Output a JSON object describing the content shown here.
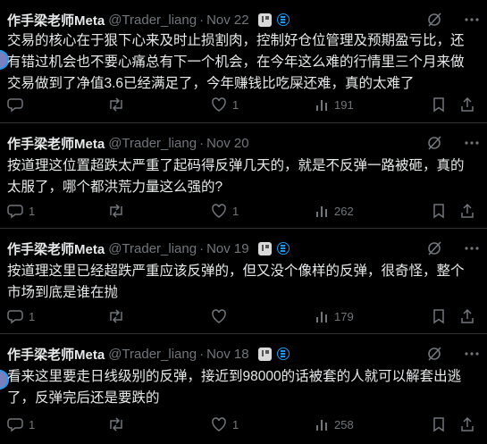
{
  "tweets": [
    {
      "name": "作手梁老师Meta",
      "handle": "@Trader_liang",
      "date": "Nov 22",
      "text": "交易的核心在于狠下心来及时止损割肉，控制好仓位管理及预期盈亏比，还有错过机会也不要心痛总有下一个机会，在今年这么难的行情里三个月来做交易做到了净值3.6已经满足了，今年赚钱比吃屎还难，真的太难了",
      "replies": "",
      "retweets": "",
      "likes": "1",
      "views": "191"
    },
    {
      "name": "作手梁老师Meta",
      "handle": "@Trader_liang",
      "date": "Nov 20",
      "text": "按道理这位置超跌太严重了起码得反弹几天的，就是不反弹一路被砸，真的太服了，哪个都洪荒力量这么强的?",
      "replies": "1",
      "retweets": "",
      "likes": "1",
      "views": "262"
    },
    {
      "name": "作手梁老师Meta",
      "handle": "@Trader_liang",
      "date": "Nov 19",
      "text": "按道理这里已经超跌严重应该反弹的，但又没个像样的反弹，很奇怪，整个市场到底是谁在抛",
      "replies": "1",
      "retweets": "",
      "likes": "",
      "views": "179"
    },
    {
      "name": "作手梁老师Meta",
      "handle": "@Trader_liang",
      "date": "Nov 18",
      "text": "看来这里要走日线级别的反弹，接近到98000的话被套的人就可以解套出逃了，反弹完后还是要跌的",
      "replies": "1",
      "retweets": "",
      "likes": "1",
      "views": "258"
    }
  ],
  "colors": {
    "background": "#000000",
    "text": "#e7e9ea",
    "muted": "#71767b",
    "divider": "#2f3336",
    "accent": "#1d9bf0"
  },
  "icons": {
    "header_badges": [
      "affiliate-flag-icon",
      "verified-badge-icon"
    ],
    "header_actions": [
      "grok-icon",
      "more-icon"
    ],
    "actions": [
      "reply-icon",
      "retweet-icon",
      "like-icon",
      "views-icon",
      "bookmark-icon",
      "share-icon"
    ]
  }
}
